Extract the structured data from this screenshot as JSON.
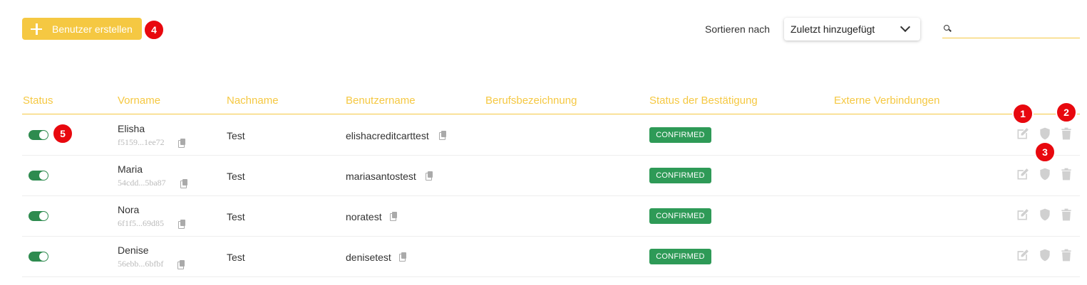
{
  "toolbar": {
    "create_button": "Benutzer erstellen",
    "sort_label": "Sortieren nach",
    "sort_value": "Zuletzt hinzugefügt",
    "search_value": ""
  },
  "table": {
    "headers": [
      "Status",
      "Vorname",
      "Nachname",
      "Benutzername",
      "Berufsbezeichnung",
      "Status der Bestätigung",
      "Externe Verbindungen"
    ],
    "rows": [
      {
        "enabled": true,
        "first_name": "Elisha",
        "id_short": "f5159...1ee72",
        "last_name": "Test",
        "username": "elishacreditcarttest",
        "job_title": "",
        "confirmation": "CONFIRMED"
      },
      {
        "enabled": true,
        "first_name": "Maria",
        "id_short": "54cdd...5ba87",
        "last_name": "Test",
        "username": "mariasantostest",
        "job_title": "",
        "confirmation": "CONFIRMED"
      },
      {
        "enabled": true,
        "first_name": "Nora",
        "id_short": "6f1f5...69d85",
        "last_name": "Test",
        "username": "noratest",
        "job_title": "",
        "confirmation": "CONFIRMED"
      },
      {
        "enabled": true,
        "first_name": "Denise",
        "id_short": "56ebb...6bfbf",
        "last_name": "Test",
        "username": "denisetest",
        "job_title": "",
        "confirmation": "CONFIRMED"
      }
    ]
  },
  "annotations": [
    "1",
    "2",
    "3",
    "4",
    "5"
  ],
  "icons": {
    "edit": "edit-icon",
    "security": "shield-icon",
    "delete": "trash-icon",
    "copy": "copy-icon",
    "search": "search-icon",
    "add": "plus-icon",
    "dropdown": "chevron-down-icon"
  },
  "colors": {
    "accent": "#f5c842",
    "confirmed": "#2e9a57",
    "toggle_on": "#2e8b4f",
    "badge": "#e8080e",
    "icon_gray": "#d0d0d0"
  }
}
